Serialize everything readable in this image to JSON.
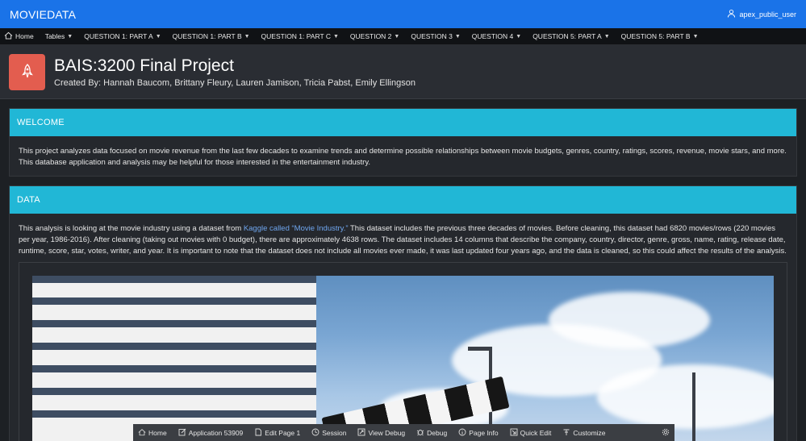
{
  "app": {
    "title": "MOVIEDATA",
    "user": "apex_public_user"
  },
  "nav": [
    {
      "label": "Home",
      "icon": "home-icon",
      "chevron": false
    },
    {
      "label": "Tables",
      "chevron": true
    },
    {
      "label": "QUESTION 1: PART A",
      "chevron": true
    },
    {
      "label": "QUESTION 1: PART B",
      "chevron": true
    },
    {
      "label": "QUESTION 1: PART C",
      "chevron": true
    },
    {
      "label": "QUESTION 2",
      "chevron": true
    },
    {
      "label": "QUESTION 3",
      "chevron": true
    },
    {
      "label": "QUESTION 4",
      "chevron": true
    },
    {
      "label": "QUESTION 5: PART A",
      "chevron": true
    },
    {
      "label": "QUESTION 5: PART B",
      "chevron": true
    }
  ],
  "hero": {
    "icon": "rocket-icon",
    "title": "BAIS:3200 Final Project",
    "subtitle": "Created By: Hannah Baucom, Brittany Fleury, Lauren Jamison, Tricia Pabst, Emily Ellingson"
  },
  "welcome": {
    "heading": "WELCOME",
    "text": "This project analyzes data focused on movie revenue from the last few decades to examine trends and determine possible relationships between movie budgets, genres, country, ratings, scores, revenue, movie stars, and more. This database application and analysis may be helpful for those interested in the entertainment industry."
  },
  "data_section": {
    "heading": "DATA",
    "text_before": "This analysis is looking at the movie industry using a dataset from ",
    "link": "Kaggle called “Movie Industry.”",
    "text_after": " This dataset includes the previous three decades of movies. Before cleaning, this dataset had 6820 movies/rows (220 movies per year, 1986-2016). After cleaning (taking out movies with 0 budget), there are approximately 4638 rows. The dataset includes 14 columns that describe the company, country, director, genre, gross, name, rating, release date, runtime, score, star, votes, writer, and year. It is important to note that the dataset does not include all movies ever made, it was last updated four years ago, and the data is cleaned, so this could affect the results of the analysis."
  },
  "devbar": [
    {
      "label": "Home",
      "icon": "home-icon"
    },
    {
      "label": "Application 53909",
      "icon": "edit-icon"
    },
    {
      "label": "Edit Page 1",
      "icon": "document-icon"
    },
    {
      "label": "Session",
      "icon": "session-icon"
    },
    {
      "label": "View Debug",
      "icon": "view-debug-icon"
    },
    {
      "label": "Debug",
      "icon": "bug-icon"
    },
    {
      "label": "Page Info",
      "icon": "info-icon"
    },
    {
      "label": "Quick Edit",
      "icon": "quick-edit-icon"
    },
    {
      "label": "Customize",
      "icon": "customize-icon"
    }
  ]
}
